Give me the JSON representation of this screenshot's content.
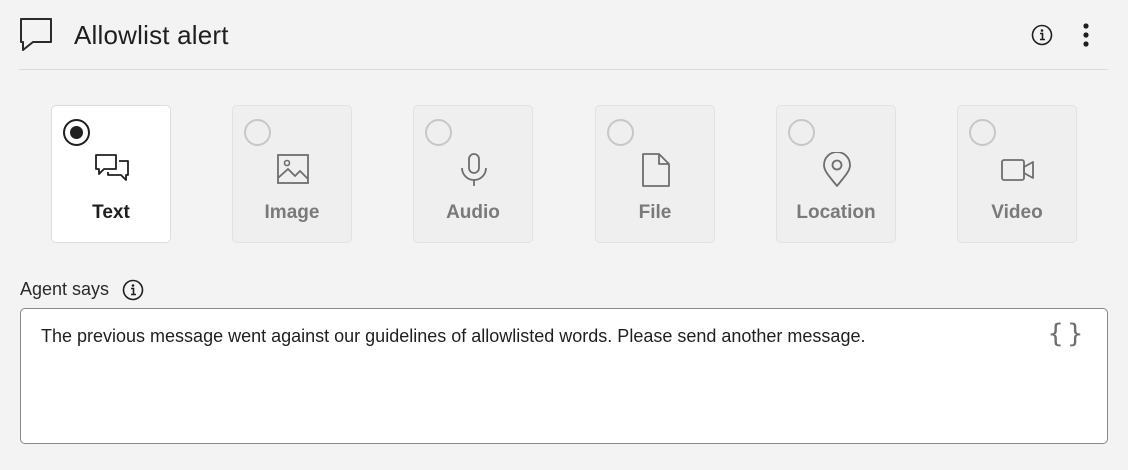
{
  "header": {
    "title": "Allowlist alert"
  },
  "types": [
    {
      "label": "Text",
      "icon": "chat-bubbles-icon",
      "selected": true
    },
    {
      "label": "Image",
      "icon": "image-icon",
      "selected": false
    },
    {
      "label": "Audio",
      "icon": "microphone-icon",
      "selected": false
    },
    {
      "label": "File",
      "icon": "file-icon",
      "selected": false
    },
    {
      "label": "Location",
      "icon": "location-pin-icon",
      "selected": false
    },
    {
      "label": "Video",
      "icon": "video-camera-icon",
      "selected": false
    }
  ],
  "agent": {
    "label": "Agent says",
    "message": "The previous message went against our guidelines of allowlisted words. Please send another message.",
    "variable_button": "{}"
  },
  "colors": {
    "background": "#f3f3f3",
    "selected_card": "#ffffff",
    "unselected_card": "#efefef",
    "text_primary": "#1f1f1f",
    "text_muted": "#7a7a7a"
  }
}
